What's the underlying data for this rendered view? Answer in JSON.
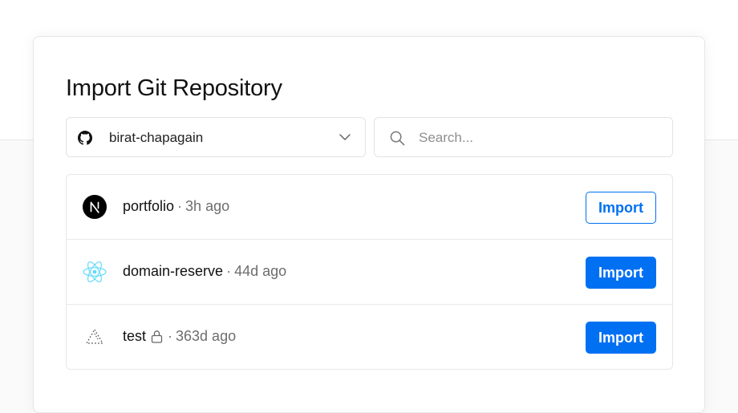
{
  "title": "Import Git Repository",
  "account_selector": {
    "label": "birat-chapagain",
    "icon": "github-icon"
  },
  "search": {
    "placeholder": "Search...",
    "value": "",
    "icon": "search-icon"
  },
  "repos": [
    {
      "name": "portfolio",
      "separator": "·",
      "time": "3h ago",
      "icon": "nextjs-icon",
      "private": false,
      "import_label": "Import",
      "button_style": "outline"
    },
    {
      "name": "domain-reserve",
      "separator": "·",
      "time": "44d ago",
      "icon": "react-icon",
      "private": false,
      "import_label": "Import",
      "button_style": "solid"
    },
    {
      "name": "test",
      "separator": "·",
      "time": "363d ago",
      "icon": "vercel-icon",
      "private": true,
      "import_label": "Import",
      "button_style": "solid"
    }
  ],
  "colors": {
    "accent": "#0070f3",
    "react": "#61dafb"
  }
}
